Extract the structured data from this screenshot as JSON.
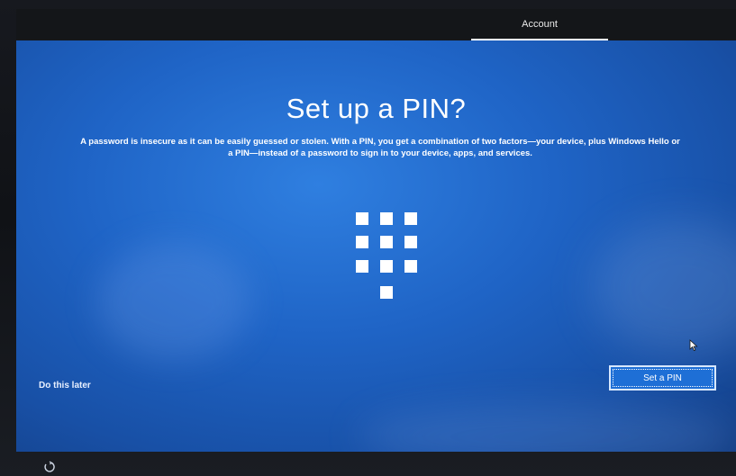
{
  "header": {
    "tab_label": "Account"
  },
  "main": {
    "title": "Set up a PIN?",
    "description": "A password is insecure as it can be easily guessed or stolen. With a PIN, you get a combination of two factors—your device, plus Windows Hello or a PIN—instead of a password to sign in to your device, apps, and services.",
    "illustration_icon": "keypad-icon"
  },
  "footer": {
    "skip_label": "Do this later",
    "primary_label": "Set a PIN",
    "ease_of_access_icon": "ease-of-access-icon"
  },
  "colors": {
    "background_blue": "#1f64c6",
    "button_blue": "#1e6fd6",
    "text": "#ffffff"
  }
}
